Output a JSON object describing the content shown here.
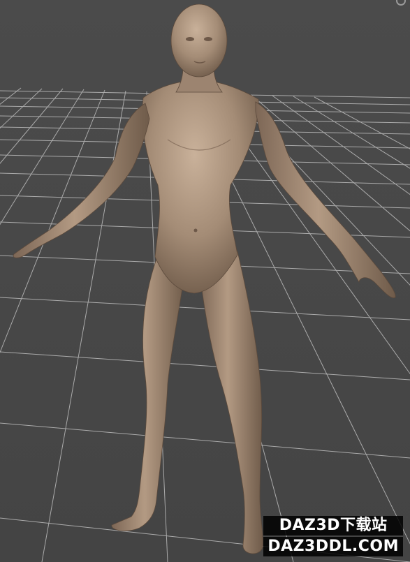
{
  "viewport": {
    "background_color": "#474747",
    "grid_color": "#cfcfcf",
    "skin_color": "#a48c76"
  },
  "corner_control": {
    "icon": "orbit-icon"
  },
  "watermark": {
    "line1": "DAZ3D下载站",
    "line2": "DAZ3DDL.COM"
  }
}
